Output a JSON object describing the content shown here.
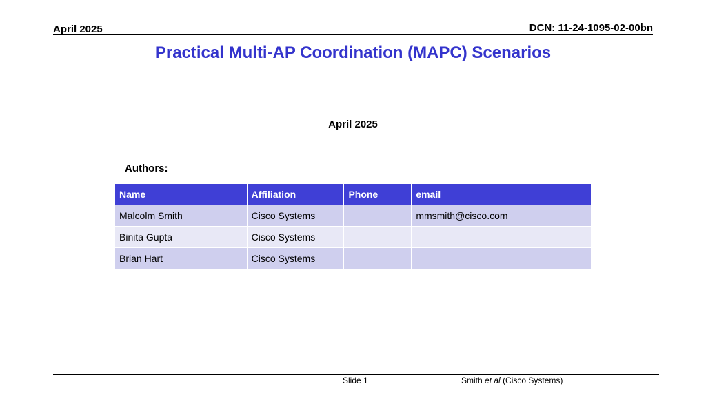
{
  "header": {
    "date": "April 2025",
    "dcn": "DCN: 11-24-1095-02-00bn"
  },
  "title": "Practical Multi-AP Coordination (MAPC) Scenarios",
  "date_line": "April 2025",
  "authors_label": "Authors:",
  "table": {
    "columns": [
      "Name",
      "Affiliation",
      "Phone",
      "email"
    ],
    "rows": [
      [
        "Malcolm Smith",
        "Cisco Systems",
        "",
        "mmsmith@cisco.com"
      ],
      [
        "Binita Gupta",
        "Cisco Systems",
        "",
        ""
      ],
      [
        "Brian Hart",
        "Cisco Systems",
        "",
        ""
      ]
    ]
  },
  "footer": {
    "slide": "Slide 1",
    "author_name": "Smith",
    "author_etal": "et al",
    "author_org": "(Cisco Systems)"
  },
  "colors": {
    "title": "#3333cc",
    "table_header": "#3f3fd6",
    "row_odd": "#cfcfee",
    "row_even": "#e8e8f6"
  }
}
